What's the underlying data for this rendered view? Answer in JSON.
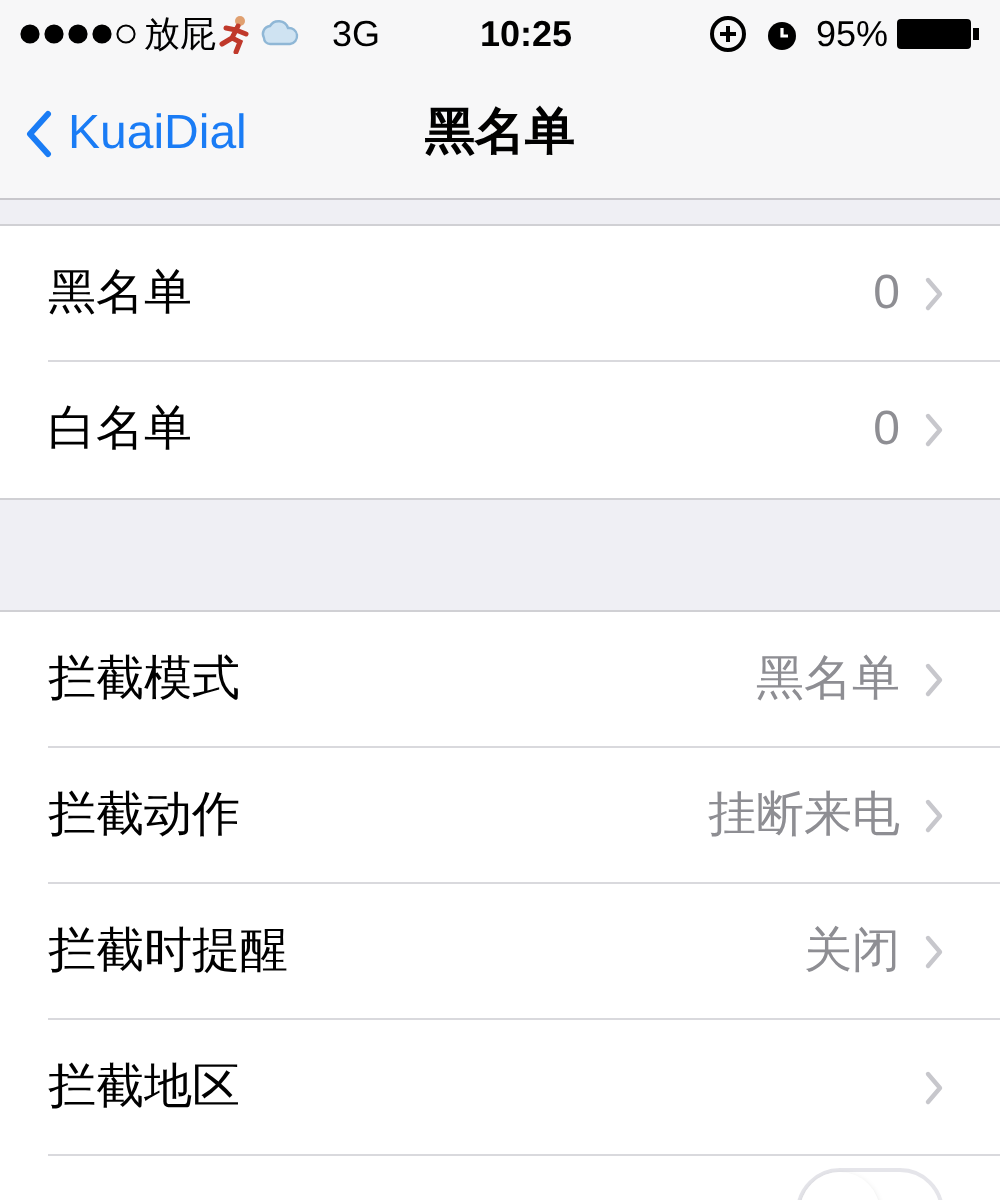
{
  "status_bar": {
    "carrier": "放屁",
    "network": "3G",
    "time": "10:25",
    "battery": "95%"
  },
  "nav": {
    "back": "KuaiDial",
    "title": "黑名单"
  },
  "sections": [
    {
      "rows": [
        {
          "kind": "link",
          "label": "黑名单",
          "value": "0"
        },
        {
          "kind": "link",
          "label": "白名单",
          "value": "0"
        }
      ]
    },
    {
      "rows": [
        {
          "kind": "link",
          "label": "拦截模式",
          "value": "黑名单"
        },
        {
          "kind": "link",
          "label": "拦截动作",
          "value": "挂断来电"
        },
        {
          "kind": "link",
          "label": "拦截时提醒",
          "value": "关闭"
        },
        {
          "kind": "link",
          "label": "拦截地区"
        },
        {
          "kind": "toggle",
          "on": false
        }
      ]
    }
  ]
}
